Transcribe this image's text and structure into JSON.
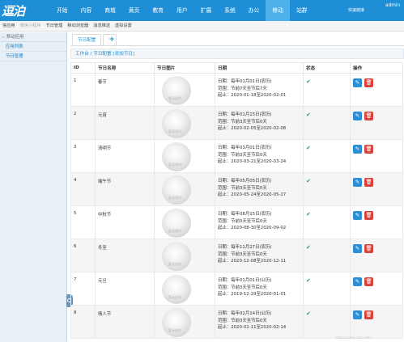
{
  "app": {
    "logo_text": "逗泊",
    "quick_link": "快速链接",
    "user": "admin"
  },
  "nav": [
    "开始",
    "内容",
    "商城",
    "黄页",
    "教育",
    "用户",
    "扩展",
    "系统",
    "办公",
    "移动",
    "站群"
  ],
  "nav_active": "移动",
  "subnav": [
    "信应用",
    "微信小程序",
    "节日管理",
    "移动浏览器",
    "消息推送",
    "虚拟设置"
  ],
  "sidebar": {
    "title": "移动应用",
    "items": [
      "应用列表",
      "节日管理"
    ]
  },
  "tabs": {
    "active": "节日配置",
    "add": "+"
  },
  "breadcrumb": "工作台 / 节日配置 [添加节日]",
  "table": {
    "headers": [
      "ID",
      "节日名称",
      "节日图片",
      "日期",
      "状态",
      "操作"
    ],
    "image_placeholder": "暂无图片",
    "rows": [
      {
        "id": "1",
        "name": "春节",
        "d1": "日期：每年01月01日(农历)",
        "d2": "范围：节前7天至节后7天",
        "d3": "起止：2020-01-18至2020-02-01",
        "status": "✔"
      },
      {
        "id": "2",
        "name": "元宵",
        "d1": "日期：每年01月15日(农历)",
        "d2": "范围：节前3天至节后0天",
        "d3": "起止：2020-02-05至2020-02-08",
        "status": "✔"
      },
      {
        "id": "3",
        "name": "清明节",
        "d1": "日期：每年03月01日(农历)",
        "d2": "范围：节前3天至节后0天",
        "d3": "起止：2020-03-21至2020-03-24",
        "status": "✔"
      },
      {
        "id": "4",
        "name": "端午节",
        "d1": "日期：每年05月05日(农历)",
        "d2": "范围：节前3天至节后0天",
        "d3": "起止：2020-05-24至2020-05-27",
        "status": "✔"
      },
      {
        "id": "5",
        "name": "中秋节",
        "d1": "日期：每年08月15日(农历)",
        "d2": "范围：节前3天至节后0天",
        "d3": "起止：2020-08-30至2020-09-02",
        "status": "✔"
      },
      {
        "id": "6",
        "name": "冬至",
        "d1": "日期：每年11月27日(农历)",
        "d2": "范围：节前3天至节后0天",
        "d3": "起止：2020-12-08至2020-12-11",
        "status": "✔"
      },
      {
        "id": "7",
        "name": "元旦",
        "d1": "日期：每年01月01日(公历)",
        "d2": "范围：节前3天至节后0天",
        "d3": "起止：2019-12-29至2020-01-01",
        "status": "✔"
      },
      {
        "id": "8",
        "name": "情人节",
        "d1": "日期：每年02月14日(公历)",
        "d2": "范围：节前3天至节后0天",
        "d3": "起止：2020-02-11至2020-02-14",
        "status": "✔"
      }
    ]
  },
  "icons": {
    "edit": "pencil-icon",
    "delete": "trash-icon",
    "sidebar_toggle": "collapse-handle-icon"
  },
  "colors": {
    "primary": "#1e8fd6",
    "active_nav": "#4eb0ea",
    "edit": "#2a8fd4",
    "delete": "#d9433b",
    "status_ok": "#2aa14a"
  },
  "watermark": "https://blog.csdn.net/..."
}
